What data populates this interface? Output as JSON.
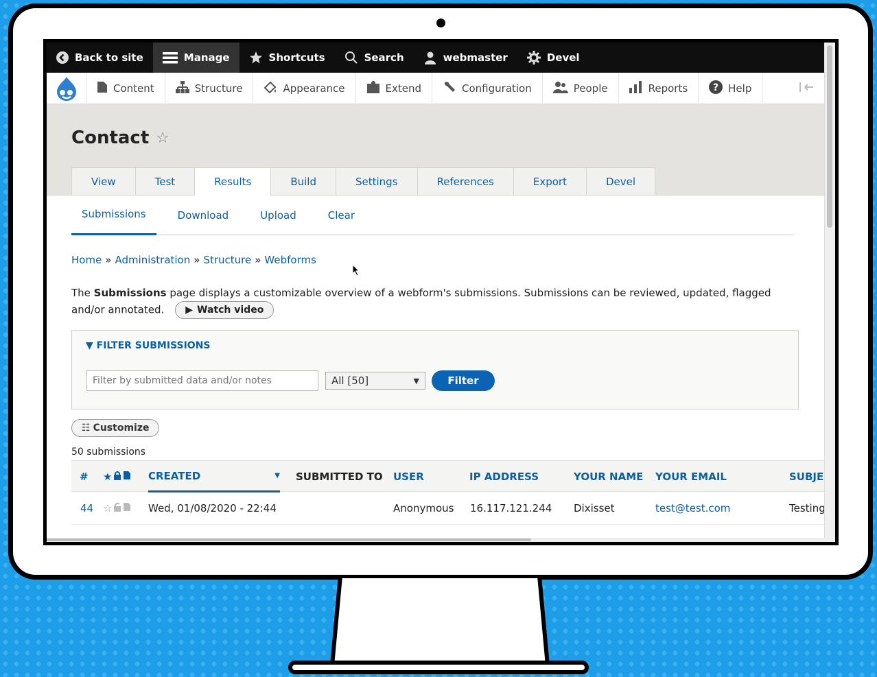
{
  "toolbar": {
    "back_to_site": "Back to site",
    "manage": "Manage",
    "shortcuts": "Shortcuts",
    "search": "Search",
    "user": "webmaster",
    "devel": "Devel"
  },
  "tray": {
    "items": [
      "Content",
      "Structure",
      "Appearance",
      "Extend",
      "Configuration",
      "People",
      "Reports",
      "Help"
    ]
  },
  "page": {
    "title": "Contact",
    "tabs": [
      "View",
      "Test",
      "Results",
      "Build",
      "Settings",
      "References",
      "Export",
      "Devel"
    ],
    "active_tab": "Results",
    "subtabs": [
      "Submissions",
      "Download",
      "Upload",
      "Clear"
    ],
    "active_subtab": "Submissions",
    "breadcrumb": [
      "Home",
      "Administration",
      "Structure",
      "Webforms"
    ],
    "desc_prefix": "The ",
    "desc_bold": "Submissions",
    "desc_rest": " page displays a customizable overview of a webform's submissions. Submissions can be reviewed, updated, flagged and/or annotated.",
    "watch_video": "Watch video"
  },
  "filter": {
    "title": "FILTER SUBMISSIONS",
    "placeholder": "Filter by submitted data and/or notes",
    "select_value": "All [50]",
    "button": "Filter"
  },
  "customize": "Customize",
  "count": "50 submissions",
  "table": {
    "headers": {
      "sid": "#",
      "created": "CREATED",
      "submitted_to": "SUBMITTED TO",
      "user": "USER",
      "ip": "IP ADDRESS",
      "name": "YOUR NAME",
      "email": "YOUR EMAIL",
      "subject": "SUBJEC"
    },
    "rows": [
      {
        "sid": "44",
        "created": "Wed, 01/08/2020 - 22:44",
        "user": "Anonymous",
        "ip": "16.117.121.244",
        "name": "Dixisset",
        "email": "test@test.com",
        "subject": "Testing"
      }
    ]
  }
}
